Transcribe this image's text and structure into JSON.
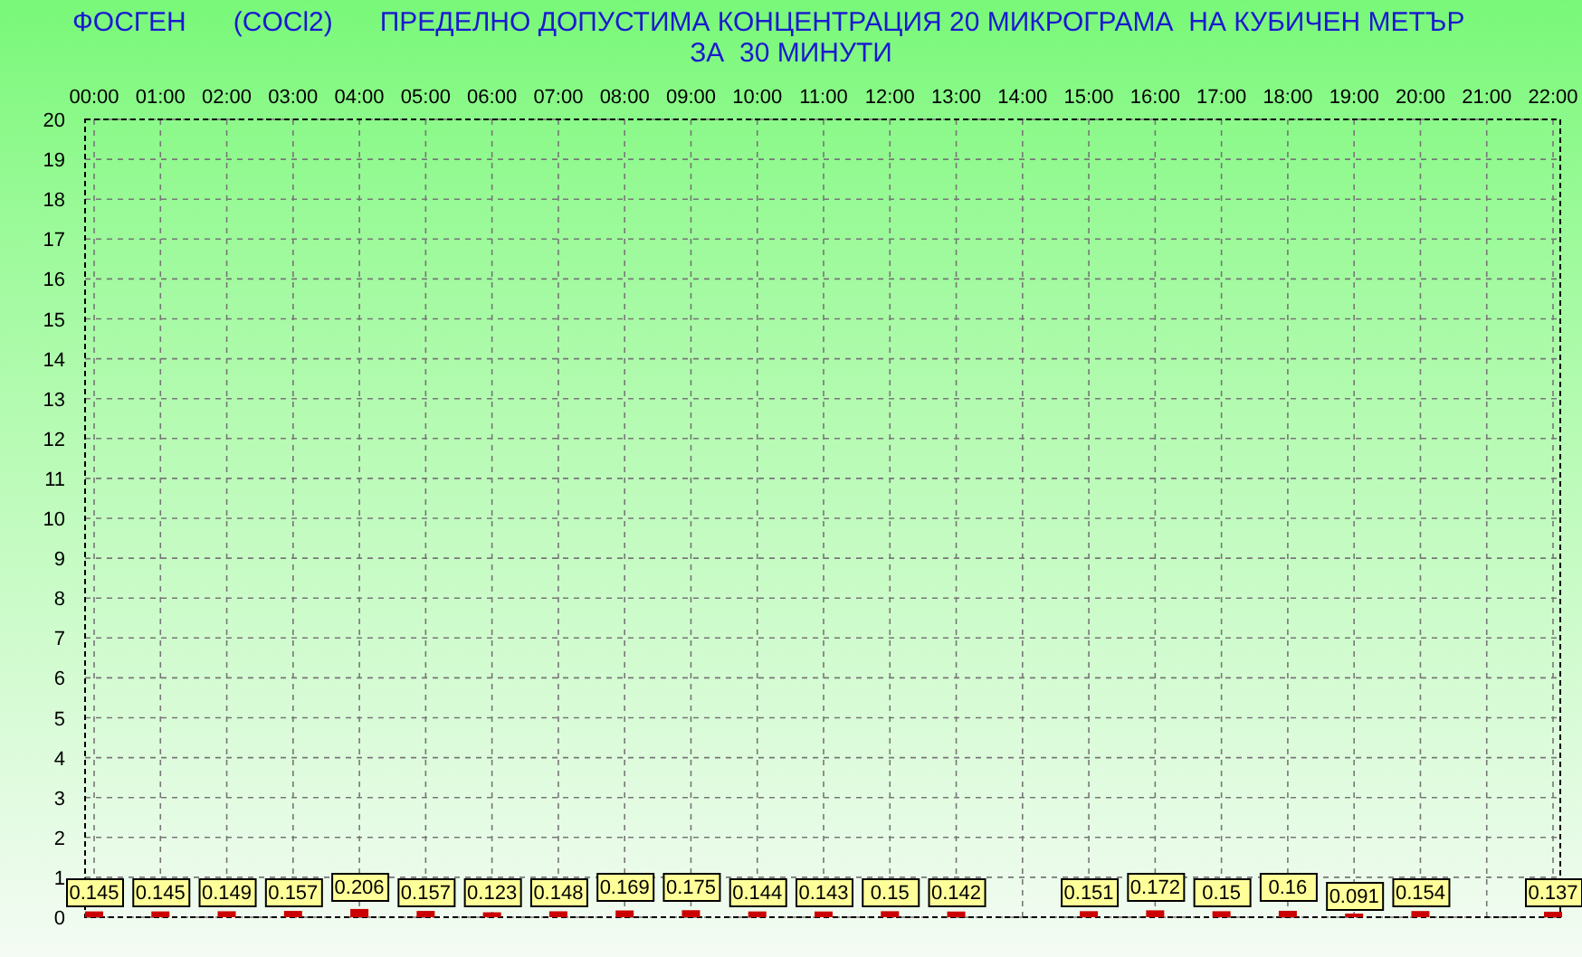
{
  "title": {
    "line_1": [
      "ФОСГЕН",
      "(COCl2)",
      "ПРЕДЕЛНО ДОПУСТИМА КОНЦЕНТРАЦИЯ 20 МИКРОГРАМА  НА КУБИЧЕН МЕТЪР"
    ],
    "line_2": "ЗА  30 МИНУТИ"
  },
  "chart_data": {
    "type": "bar",
    "data_labels": true,
    "grid": true,
    "categories": [
      "00:00",
      "01:00",
      "02:00",
      "03:00",
      "04:00",
      "05:00",
      "06:00",
      "07:00",
      "08:00",
      "09:00",
      "10:00",
      "11:00",
      "12:00",
      "13:00",
      "14:00",
      "15:00",
      "16:00",
      "17:00",
      "18:00",
      "19:00",
      "20:00",
      "21:00",
      "22:00"
    ],
    "series": [
      {
        "color": "#cc0000",
        "values": [
          0.145,
          0.145,
          0.149,
          0.157,
          0.206,
          0.157,
          0.123,
          0.148,
          0.169,
          0.175,
          0.144,
          0.143,
          0.15,
          0.142,
          null,
          0.151,
          0.172,
          0.15,
          0.16,
          0.091,
          0.154,
          null,
          0.137
        ]
      }
    ],
    "ylim": [
      0,
      20
    ],
    "yticks": [
      0,
      1,
      2,
      3,
      4,
      5,
      6,
      7,
      8,
      9,
      10,
      11,
      12,
      13,
      14,
      15,
      16,
      17,
      18,
      19,
      20
    ]
  }
}
